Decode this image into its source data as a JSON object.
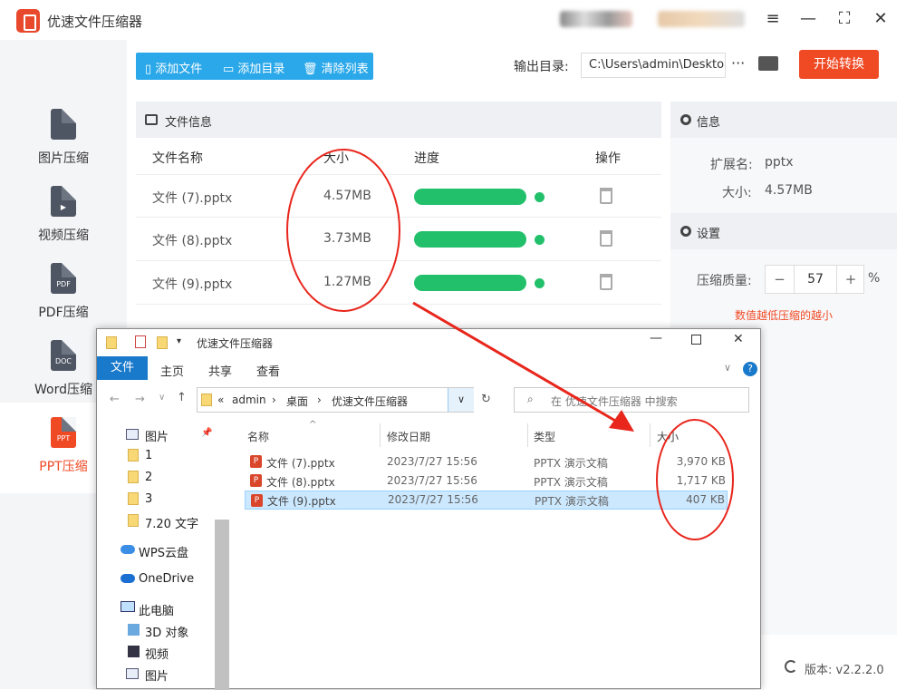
{
  "app": {
    "title": "优速文件压缩器"
  },
  "nav": [
    {
      "label": "图片压缩",
      "icon": "image-file-icon",
      "glyph": ""
    },
    {
      "label": "视频压缩",
      "icon": "video-file-icon",
      "glyph": "▶"
    },
    {
      "label": "PDF压缩",
      "icon": "pdf-file-icon",
      "glyph": "PDF"
    },
    {
      "label": "Word压缩",
      "icon": "doc-file-icon",
      "glyph": "DOC"
    },
    {
      "label": "PPT压缩",
      "icon": "ppt-file-icon",
      "glyph": "PPT",
      "active": true
    }
  ],
  "toolbar": {
    "add_file": "添加文件",
    "add_dir": "添加目录",
    "clear": "清除列表"
  },
  "output": {
    "label": "输出目录:",
    "path": "C:\\Users\\admin\\Deskto",
    "more": "···",
    "start": "开始转换"
  },
  "file_panel": {
    "title": "文件信息",
    "columns": [
      "文件名称",
      "大小",
      "进度",
      "操作"
    ],
    "rows": [
      {
        "name": "文件 (7).pptx",
        "size": "4.57MB",
        "progress": 1.0
      },
      {
        "name": "文件 (8).pptx",
        "size": "3.73MB",
        "progress": 1.0
      },
      {
        "name": "文件 (9).pptx",
        "size": "1.27MB",
        "progress": 1.0
      }
    ]
  },
  "info": {
    "title": "信息",
    "ext_label": "扩展名:",
    "ext": "pptx",
    "size_label": "大小:",
    "size": "4.57MB"
  },
  "settings": {
    "title": "设置",
    "quality_label": "压缩质量:",
    "minus": "−",
    "quality": "57",
    "plus": "+",
    "percent": "%",
    "hint": "数值越低压缩的越小"
  },
  "version": {
    "label": "版本:",
    "value": "v2.2.2.0"
  },
  "explorer": {
    "title": "优速文件压缩器",
    "ribbon_tabs": [
      "文件",
      "主页",
      "共享",
      "查看"
    ],
    "breadcrumb": [
      "«",
      "admin",
      "›",
      "桌面",
      "›",
      "优速文件压缩器"
    ],
    "search_placeholder": "在 优速文件压缩器 中搜索",
    "tree": [
      "图片",
      "1",
      "2",
      "3",
      "7.20 文字",
      "WPS云盘",
      "OneDrive",
      "此电脑",
      "3D 对象",
      "视频",
      "图片"
    ],
    "columns": [
      "名称",
      "修改日期",
      "类型",
      "大小"
    ],
    "files": [
      {
        "name": "文件 (7).pptx",
        "date": "2023/7/27 15:56",
        "type": "PPTX 演示文稿",
        "size": "3,970 KB"
      },
      {
        "name": "文件 (8).pptx",
        "date": "2023/7/27 15:56",
        "type": "PPTX 演示文稿",
        "size": "1,717 KB"
      },
      {
        "name": "文件 (9).pptx",
        "date": "2023/7/27 15:56",
        "type": "PPTX 演示文稿",
        "size": "407 KB",
        "selected": true
      }
    ]
  },
  "colors": {
    "accent": "#f04a25",
    "toolbar_blue": "#2aa8ea",
    "progress_green": "#22c06b",
    "annotation_red": "#e8261c"
  }
}
